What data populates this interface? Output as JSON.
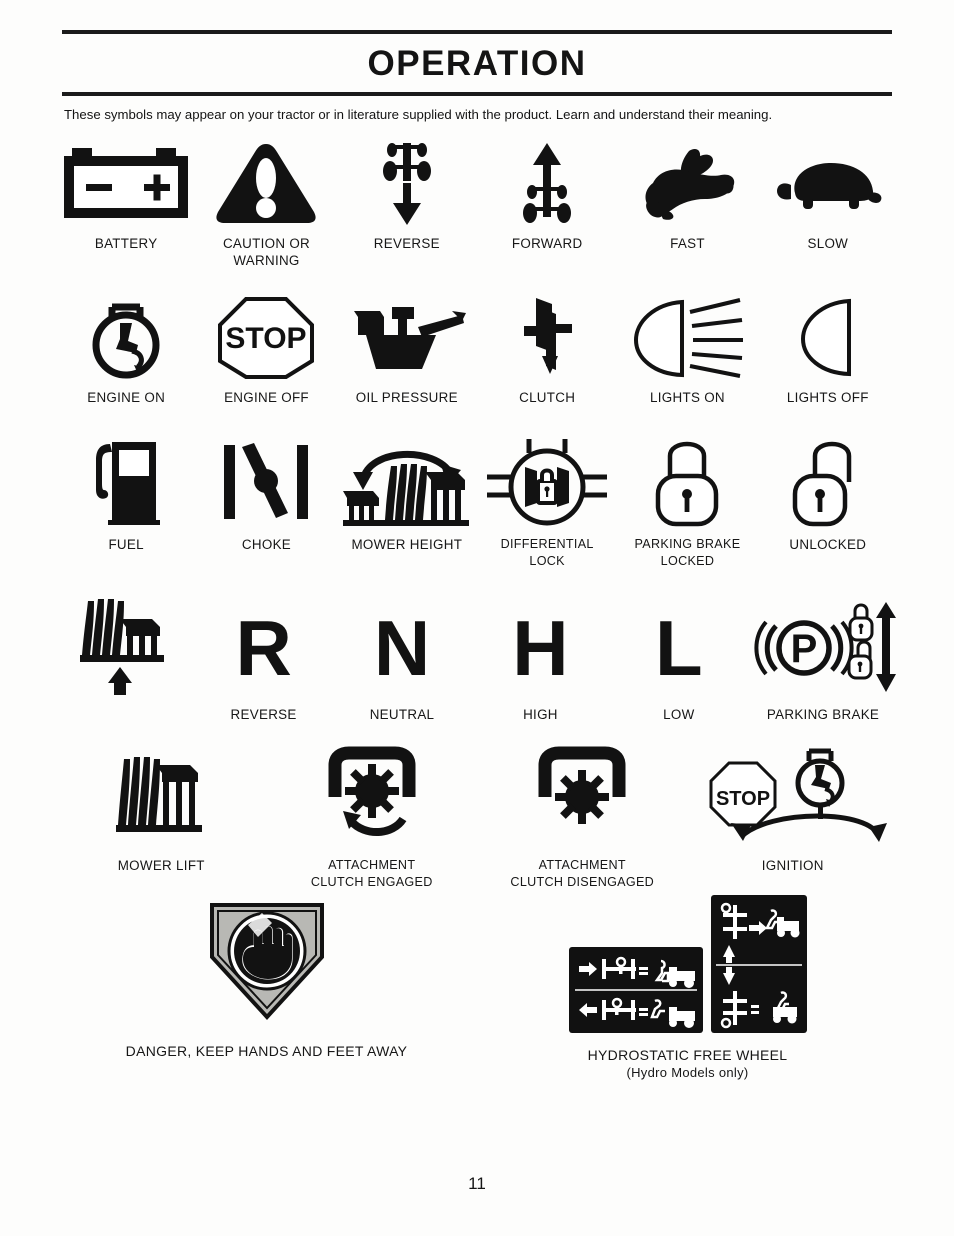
{
  "document": {
    "title": "OPERATION",
    "intro": "These symbols may appear on your tractor or in literature supplied with the product.  Learn and understand their meaning.",
    "page_number": "11"
  },
  "rows": [
    {
      "id": "row-1",
      "cells": [
        {
          "icon": "battery-icon",
          "label": "BATTERY"
        },
        {
          "icon": "caution-warning-triangle-icon",
          "label": "CAUTION OR\nWARNING"
        },
        {
          "icon": "tractor-reverse-icon",
          "label": "REVERSE"
        },
        {
          "icon": "tractor-forward-icon",
          "label": "FORWARD"
        },
        {
          "icon": "rabbit-fast-icon",
          "label": "FAST"
        },
        {
          "icon": "turtle-slow-icon",
          "label": "SLOW"
        }
      ]
    },
    {
      "id": "row-2",
      "cells": [
        {
          "icon": "engine-on-icon",
          "label": "ENGINE ON"
        },
        {
          "icon": "engine-off-stop-icon",
          "label": "ENGINE OFF",
          "text": "STOP"
        },
        {
          "icon": "oil-pressure-can-icon",
          "label": "OIL PRESSURE"
        },
        {
          "icon": "clutch-icon",
          "label": "CLUTCH"
        },
        {
          "icon": "lights-on-icon",
          "label": "LIGHTS ON"
        },
        {
          "icon": "lights-off-icon",
          "label": "LIGHTS OFF"
        }
      ]
    },
    {
      "id": "row-3",
      "cells": [
        {
          "icon": "fuel-pump-icon",
          "label": "FUEL"
        },
        {
          "icon": "choke-icon",
          "label": "CHOKE"
        },
        {
          "icon": "mower-height-icon",
          "label": "MOWER HEIGHT"
        },
        {
          "icon": "differential-lock-icon",
          "label": "DIFFERENTIAL\nLOCK"
        },
        {
          "icon": "padlock-locked-icon",
          "label": "PARKING BRAKE\nLOCKED"
        },
        {
          "icon": "padlock-unlocked-icon",
          "label": "UNLOCKED"
        }
      ]
    },
    {
      "id": "row-4",
      "cells": [
        {
          "icon": "mower-lift-adjust-icon",
          "label": ""
        },
        {
          "icon": "letter-r-icon",
          "text": "R",
          "label": "REVERSE"
        },
        {
          "icon": "letter-n-icon",
          "text": "N",
          "label": "NEUTRAL"
        },
        {
          "icon": "letter-h-icon",
          "text": "H",
          "label": "HIGH"
        },
        {
          "icon": "letter-l-icon",
          "text": "L",
          "label": "LOW"
        },
        {
          "icon": "parking-brake-icon",
          "text": "P",
          "label": "PARKING BRAKE"
        }
      ]
    },
    {
      "id": "row-5",
      "cells": [
        {
          "icon": "mower-lift-icon",
          "label": "MOWER LIFT"
        },
        {
          "icon": "attachment-clutch-engaged-icon",
          "label": "ATTACHMENT\nCLUTCH ENGAGED"
        },
        {
          "icon": "attachment-clutch-disengaged-icon",
          "label": "ATTACHMENT\nCLUTCH DISENGAGED"
        },
        {
          "icon": "ignition-icon",
          "label": "IGNITION",
          "text": "STOP"
        }
      ]
    }
  ],
  "bottom": {
    "danger": {
      "icon": "danger-hand-shield-icon",
      "label": "DANGER, KEEP HANDS AND FEET AWAY"
    },
    "hydrostatic": {
      "icon": "hydrostatic-free-wheel-decal-icon",
      "label": "HYDROSTATIC FREE WHEEL",
      "sublabel": "(Hydro Models only)"
    }
  },
  "colors": {
    "ink": "#121212",
    "paper": "#fdfdfc",
    "decal_background": "#111111",
    "shield_fill": "#b8b8b4"
  }
}
